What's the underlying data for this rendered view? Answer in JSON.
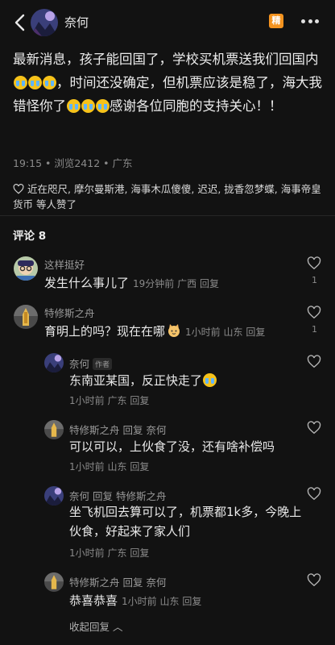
{
  "header": {
    "author": "奈何",
    "tag_label": "精"
  },
  "post": {
    "parts": [
      "最新消息，孩子能回国了，学校买机票送我们回国内",
      "，时间还没确定，但机票应该是稳了，海大我错怪你了",
      "感谢各位同胞的支持关心！！"
    ],
    "emoji_name": "crying-emoji"
  },
  "meta": {
    "time": "19:15",
    "views": "浏览2412",
    "location": "广东"
  },
  "likes": {
    "text": "近在咫尺, 摩尔曼斯港, 海事木瓜傻傻, 迟迟, 拢香忽梦蝶, 海事帝皇货币",
    "suffix": "等人赞了"
  },
  "comments_title": "评论 8",
  "comments": [
    {
      "name": "这样挺好",
      "text": "发生什么事儿了",
      "time": "19分钟前",
      "loc": "广西",
      "reply": "回复",
      "likes": "1"
    },
    {
      "name": "特修斯之舟",
      "text": "育明上的吗？现在在哪",
      "time": "1小时前",
      "loc": "山东",
      "reply": "回复",
      "likes": "1"
    }
  ],
  "replies": [
    {
      "name": "奈何",
      "badge": "作者",
      "text": "东南亚某国，反正快走了",
      "time": "1小时前",
      "loc": "广东",
      "reply": "回复"
    },
    {
      "name": "特修斯之舟",
      "reply_word": "回复",
      "target": "奈何",
      "text": "可以可以，上伙食了没，还有啥补偿吗",
      "time": "1小时前",
      "loc": "山东",
      "reply": "回复"
    },
    {
      "name": "奈何",
      "reply_word": "回复",
      "target": "特修斯之舟",
      "text": "坐飞机回去算可以了，机票都1k多，今晚上伙食，好起来了家人们",
      "time": "1小时前",
      "loc": "广东",
      "reply": "回复"
    },
    {
      "name": "特修斯之舟",
      "reply_word": "回复",
      "target": "奈何",
      "text": "恭喜恭喜",
      "time": "1小时前",
      "loc": "山东",
      "reply": "回复"
    }
  ],
  "collapse_label": "收起回复 ︿",
  "colors": {
    "background": "#121212",
    "tag": "#f4931f",
    "muted": "#8a8a8a"
  }
}
